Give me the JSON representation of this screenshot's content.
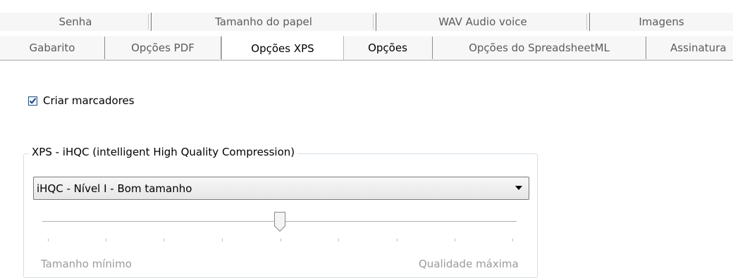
{
  "tabs_back": [
    {
      "label": "Senha"
    },
    {
      "label": "Tamanho do papel"
    },
    {
      "label": "WAV Audio voice"
    },
    {
      "label": "Imagens"
    }
  ],
  "tabs_front": [
    {
      "label": "Gabarito",
      "state": "normal"
    },
    {
      "label": "Opções PDF",
      "state": "normal"
    },
    {
      "label": "Opções XPS",
      "state": "selected"
    },
    {
      "label": "Opções",
      "state": "current"
    },
    {
      "label": "Opções do SpreadsheetML",
      "state": "normal"
    },
    {
      "label": "Assinatura",
      "state": "normal"
    }
  ],
  "options": {
    "create_bookmarks": {
      "label": "Criar marcadores",
      "checked": true
    }
  },
  "ihqc": {
    "group_title": "XPS - iHQC (intelligent High Quality Compression)",
    "selected": "iHQC - Nível I - Bom tamanho",
    "slider": {
      "value_fraction": 0.5,
      "min_label": "Tamanho mínimo",
      "max_label": "Qualidade máxima"
    }
  },
  "colors": {
    "checkbox_border": "#1c5180",
    "check_mark": "#1a3f8f",
    "muted_text": "#9a9a9a"
  }
}
